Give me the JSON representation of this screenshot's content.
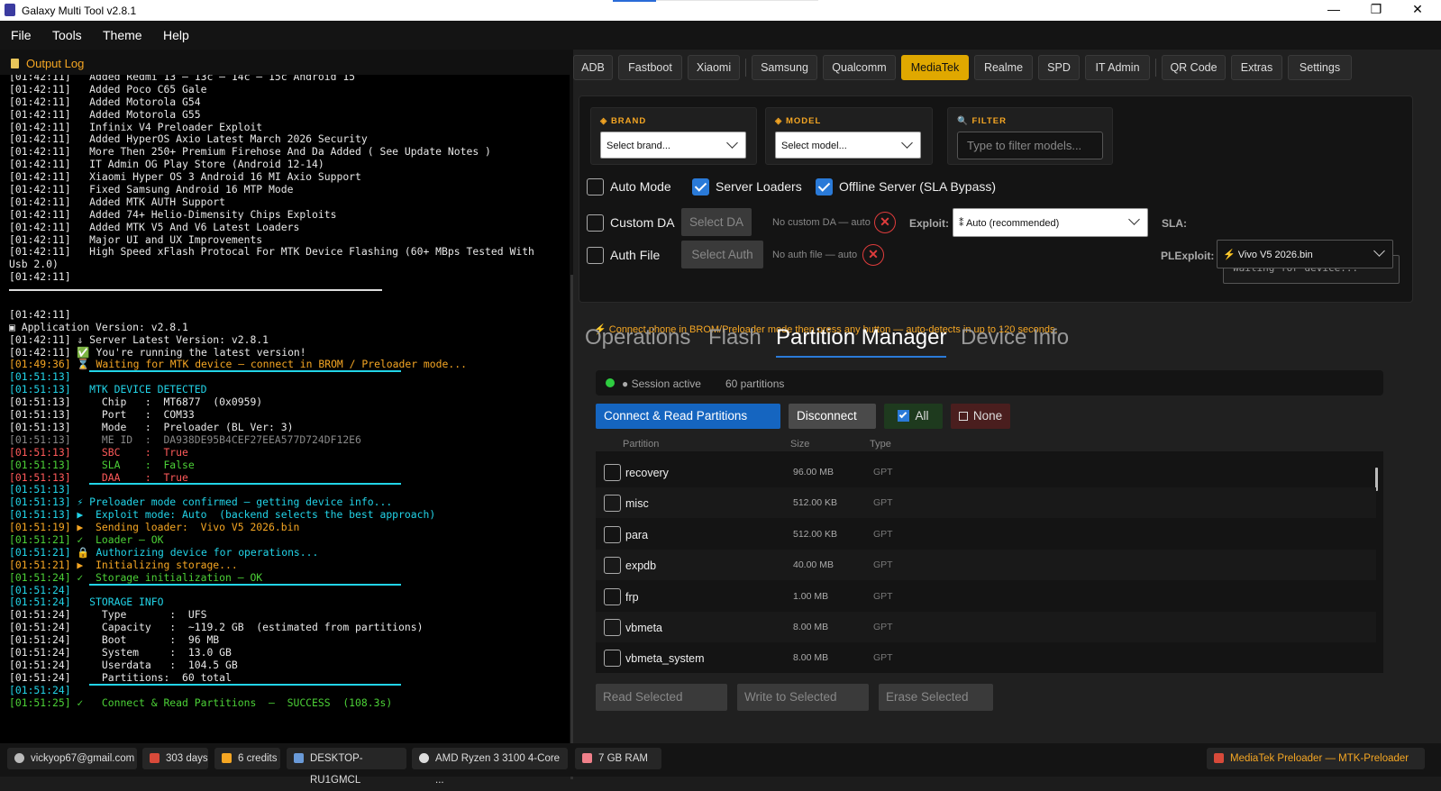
{
  "window": {
    "title": "Galaxy Multi Tool v2.8.1",
    "minimize": "—",
    "maximize": "❐",
    "close": "✕"
  },
  "menu": [
    "File",
    "Tools",
    "Theme",
    "Help"
  ],
  "output_log": {
    "title": "Output Log",
    "lines": [
      {
        "t": "[01:42:11]   Added Redmi 13 – 13c – 14c – 15c Android 15",
        "c": "def"
      },
      {
        "t": "[01:42:11]   Added Poco C65 Gale",
        "c": "def"
      },
      {
        "t": "[01:42:11]   Added Motorola G54",
        "c": "def"
      },
      {
        "t": "[01:42:11]   Added Motorola G55",
        "c": "def"
      },
      {
        "t": "[01:42:11]   Infinix V4 Preloader Exploit",
        "c": "def"
      },
      {
        "t": "[01:42:11]   Added HyperOS Axio Latest March 2026 Security",
        "c": "def"
      },
      {
        "t": "[01:42:11]   More Then 250+ Premium Firehose And Da Added ( See Update Notes )",
        "c": "def"
      },
      {
        "t": "[01:42:11]   IT Admin OG Play Store (Android 12-14)",
        "c": "def"
      },
      {
        "t": "[01:42:11]   Xiaomi Hyper OS 3 Android 16 MI Axio Support",
        "c": "def"
      },
      {
        "t": "[01:42:11]   Fixed Samsung Android 16 MTP Mode",
        "c": "def"
      },
      {
        "t": "[01:42:11]   Added MTK AUTH Support",
        "c": "def"
      },
      {
        "t": "[01:42:11]   Added 74+ Helio-Dimensity Chips Exploits",
        "c": "def"
      },
      {
        "t": "[01:42:11]   Added MTK V5 And V6 Latest Loaders",
        "c": "def"
      },
      {
        "t": "[01:42:11]   Major UI and UX Improvements",
        "c": "def"
      },
      {
        "t": "[01:42:11]   High Speed xFlash Protocal For MTK Device Flashing (60+ MBps Tested With",
        "c": "def"
      },
      {
        "t": "Usb 2.0)",
        "c": "def"
      },
      {
        "t": "[01:42:11]",
        "c": "def"
      },
      {
        "t": "",
        "c": "sepw"
      },
      {
        "t": "",
        "c": "def"
      },
      {
        "t": "[01:42:11]",
        "c": "def"
      },
      {
        "t": "▣ Application Version: v2.8.1",
        "c": "def"
      },
      {
        "t": "[01:42:11] ⇓ Server Latest Version: v2.8.1",
        "c": "def"
      },
      {
        "t": "[01:42:11] ✅ You're running the latest version!",
        "c": "def"
      },
      {
        "t": "[01:49:36] ⌛ Waiting for MTK device — connect in BROM / Preloader mode...",
        "c": "or"
      },
      {
        "t": "[01:51:13]",
        "c": "cy",
        "sep": true
      },
      {
        "t": "[01:51:13]   MTK DEVICE DETECTED",
        "c": "cy"
      },
      {
        "t": "[01:51:13]     Chip   :  MT6877  (0x0959)",
        "c": "def"
      },
      {
        "t": "[01:51:13]     Port   :  COM33",
        "c": "def"
      },
      {
        "t": "[01:51:13]     Mode   :  Preloader (BL Ver: 3)",
        "c": "def"
      },
      {
        "t": "[01:51:13]     ME ID  :  DA938DE95B4CEF27EEA577D724DF12E6",
        "c": "gy"
      },
      {
        "t": "[01:51:13]     SBC    :  True",
        "c": "rd"
      },
      {
        "t": "[01:51:13]     SLA    :  False",
        "c": "gr"
      },
      {
        "t": "[01:51:13]     DAA    :  True",
        "c": "rd"
      },
      {
        "t": "[01:51:13]",
        "c": "cy",
        "sep": true
      },
      {
        "t": "[01:51:13] ⚡ Preloader mode confirmed — getting device info...",
        "c": "cy"
      },
      {
        "t": "[01:51:13] ▶  Exploit mode: Auto  (backend selects the best approach)",
        "c": "cy"
      },
      {
        "t": "[01:51:19] ▶  Sending loader:  Vivo V5 2026.bin",
        "c": "or"
      },
      {
        "t": "[01:51:21] ✓  Loader — OK",
        "c": "gr"
      },
      {
        "t": "[01:51:21] 🔒 Authorizing device for operations...",
        "c": "cy"
      },
      {
        "t": "[01:51:21] ▶  Initializing storage...",
        "c": "or"
      },
      {
        "t": "[01:51:24] ✓  Storage initialization — OK",
        "c": "gr"
      },
      {
        "t": "[01:51:24]",
        "c": "cy",
        "sep": true
      },
      {
        "t": "[01:51:24]   STORAGE INFO",
        "c": "cy"
      },
      {
        "t": "[01:51:24]     Type       :  UFS",
        "c": "def"
      },
      {
        "t": "[01:51:24]     Capacity   :  ~119.2 GB  (estimated from partitions)",
        "c": "def"
      },
      {
        "t": "[01:51:24]     Boot       :  96 MB",
        "c": "def"
      },
      {
        "t": "[01:51:24]     System     :  13.0 GB",
        "c": "def"
      },
      {
        "t": "[01:51:24]     Userdata   :  104.5 GB",
        "c": "def"
      },
      {
        "t": "[01:51:24]     Partitions:  60 total",
        "c": "def"
      },
      {
        "t": "[01:51:24]",
        "c": "cy",
        "sep": true
      },
      {
        "t": "[01:51:25] ✓   Connect & Read Partitions  —  SUCCESS  (108.3s)",
        "c": "gr"
      }
    ]
  },
  "tabs": [
    "ADB",
    "Fastboot",
    "Xiaomi",
    "Samsung",
    "Qualcomm",
    "MediaTek",
    "Realme",
    "SPD",
    "IT Admin",
    "QR Code",
    "Extras",
    "Settings"
  ],
  "active_tab": "MediaTek",
  "brand": {
    "label": "◈ BRAND",
    "value": "Select brand..."
  },
  "model": {
    "label": "◈ MODEL",
    "value": "Select model..."
  },
  "filter": {
    "label": "🔍 FILTER",
    "placeholder": "Type to filter models..."
  },
  "options": {
    "auto_mode": {
      "label": "Auto Mode",
      "checked": false
    },
    "server_loaders": {
      "label": "Server Loaders",
      "checked": true
    },
    "offline_server": {
      "label": "Offline Server (SLA Bypass)",
      "checked": true
    },
    "custom_da": {
      "label": "Custom DA",
      "checked": false,
      "button": "Select DA",
      "hint": "No custom DA — auto"
    },
    "auth_file": {
      "label": "Auth File",
      "checked": false,
      "button": "Select Auth",
      "hint": "No auth file — auto"
    }
  },
  "exploit": {
    "label": "Exploit:",
    "value": "⁑  Auto (recommended)"
  },
  "sla": {
    "label": "SLA:",
    "value": "Waiting for device..."
  },
  "plexploit": {
    "label": "PLExploit:",
    "value": "⚡  Vivo V5 2026.bin"
  },
  "warning": "⚡  Connect phone in BROM/Preloader mode then press any button — auto-detects in up to 120 seconds.",
  "sub_tabs": [
    "Operations",
    "Flash",
    "Partition Manager",
    "Device Info"
  ],
  "active_sub_tab": "Partition Manager",
  "session": {
    "status": "● Session active",
    "partitions": "60 partitions",
    "status_color": "#2ecc40"
  },
  "actions": {
    "connect": "Connect & Read Partitions",
    "disconnect": "Disconnect",
    "all": "All",
    "none": "None"
  },
  "columns": [
    "Partition",
    "Size",
    "Type"
  ],
  "partitions": [
    {
      "name": "recovery",
      "size": "96.00 MB",
      "type": "GPT"
    },
    {
      "name": "misc",
      "size": "512.00 KB",
      "type": "GPT"
    },
    {
      "name": "para",
      "size": "512.00 KB",
      "type": "GPT"
    },
    {
      "name": "expdb",
      "size": "40.00 MB",
      "type": "GPT"
    },
    {
      "name": "frp",
      "size": "1.00 MB",
      "type": "GPT"
    },
    {
      "name": "vbmeta",
      "size": "8.00 MB",
      "type": "GPT"
    },
    {
      "name": "vbmeta_system",
      "size": "8.00 MB",
      "type": "GPT"
    }
  ],
  "bottom_buttons": [
    "Read Selected",
    "Write to Selected",
    "Erase Selected"
  ],
  "status_bar": {
    "email": "vickyop67@gmail.com",
    "days": "303 days",
    "credits": "6 credits",
    "host": "DESKTOP-RU1GMCL",
    "cpu": "AMD Ryzen 3 3100 4-Core ...",
    "ram": "7 GB RAM",
    "mode": "MediaTek Preloader — MTK-Preloader"
  },
  "colors": {
    "accent": "#e0a800",
    "blue": "#2a7ad8",
    "orange": "#f5a623",
    "cyan": "#22d4e8"
  }
}
